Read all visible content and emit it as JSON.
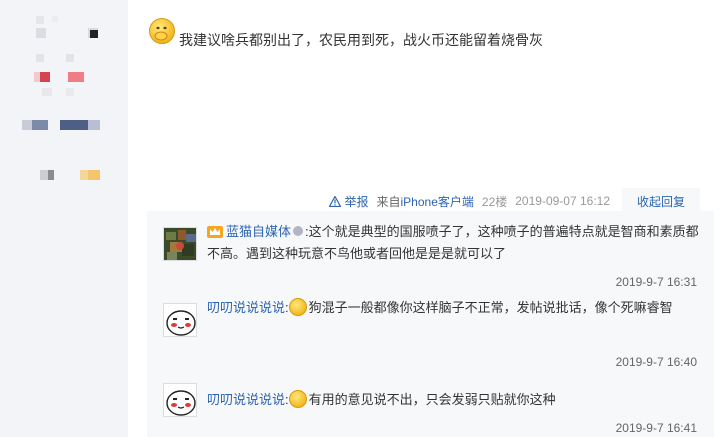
{
  "post": {
    "text": "我建议啥兵都别出了，农民用到死，战火币还能留着烧骨灰"
  },
  "meta": {
    "report_label": "举报",
    "client_prefix": "来自",
    "client_name": "iPhone客户端",
    "floor": "22楼",
    "timestamp": "2019-09-07 16:12",
    "toggle_reply_label": "收起回复"
  },
  "replies": [
    {
      "username": "蓝猫自媒体",
      "separator": ":",
      "content": "这个就是典型的国服喷子了，这种喷子的普遍特点就是智商和素质都不高。遇到这种玩意不鸟他或者回他是是是就可以了",
      "time": "2019-9-7 16:31"
    },
    {
      "username": "叨叨说说说说",
      "separator": ":",
      "content": "狗混子一般都像你这样脑子不正常，发帖说批话，像个死嘛睿智",
      "time": "2019-9-7 16:40"
    },
    {
      "username": "叨叨说说说说",
      "separator": ":",
      "content": "有用的意见说不出，只会发弱只贴就你这种",
      "time": "2019-9-7 16:41"
    }
  ],
  "colors": {
    "link": "#2d64b3",
    "reply_bg": "#f7f8fa",
    "sidebar_bg": "#f3f4f8"
  }
}
